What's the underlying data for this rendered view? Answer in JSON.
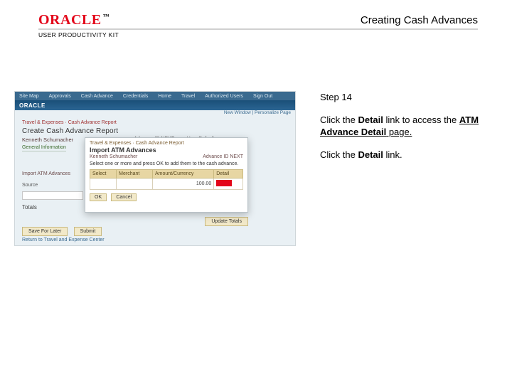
{
  "header": {
    "logo_text": "ORACLE",
    "logo_tm": "™",
    "upk": "USER PRODUCTIVITY KIT",
    "doc_title": "Creating Cash Advances"
  },
  "instructions": {
    "step_label": "Step 14",
    "para1_a": "Click the ",
    "para1_bold1": "Detail",
    "para1_b": " link to access the ",
    "para1_bold2": "ATM Advance Detail",
    "para1_c": " page.",
    "para2_a": "Click the ",
    "para2_bold": "Detail",
    "para2_b": " link."
  },
  "screenshot": {
    "nav_items": [
      "Site Map",
      "Approvals",
      "Cash Advance",
      "Credentials",
      "Home",
      "Travel",
      "Authorized Users",
      "Sign Out"
    ],
    "brand": "ORACLE",
    "subbar": "New Window | Personalize Page",
    "crumbs": "Travel & Expenses · Cash Advance Report",
    "page_title": "Create Cash Advance Report",
    "employee": "Kenneth Schumacher",
    "meta1": "Advance ID  NEXT",
    "meta2": "User Defaults",
    "tab": "General Information",
    "atm_label": "ATM Advances",
    "left_row1": "Import ATM Advances",
    "left_row2": "Source",
    "totals": "Totals",
    "update_btn": "Update Totals",
    "save_btn": "Save For Later",
    "submit_btn": "Submit",
    "return_link": "Return to Travel and Expense Center",
    "dialog": {
      "crumbs": "Travel & Expenses · Cash Advance Report",
      "title": "Import ATM Advances",
      "name": "Kenneth Schumacher",
      "name_meta": "Advance ID  NEXT",
      "instruction": "Select one or more and press OK to add them to the cash advance.",
      "cols": [
        "Select",
        "Merchant",
        "Amount/Currency",
        "Detail"
      ],
      "row": {
        "amount": "100.00"
      },
      "ok": "OK",
      "cancel": "Cancel"
    }
  }
}
